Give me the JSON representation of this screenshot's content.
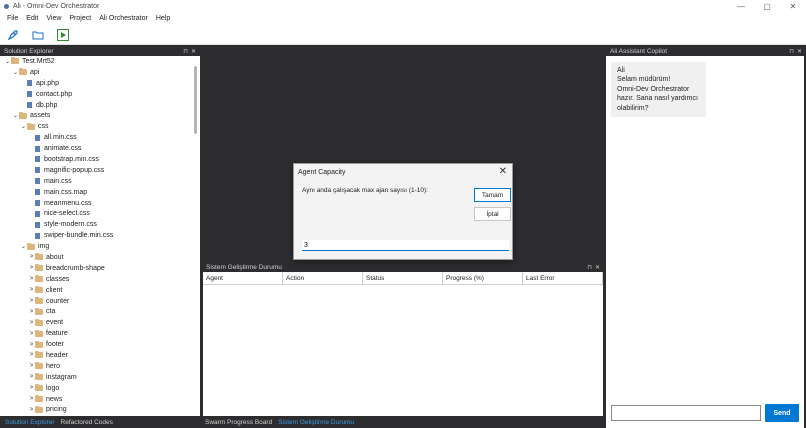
{
  "window": {
    "title": "Ali - Omni-Dev Orchestrator",
    "minimize": "—",
    "maximize": "▢",
    "close": "✕"
  },
  "menu": [
    "File",
    "Edit",
    "View",
    "Project",
    "Ali Orchestrator",
    "Help"
  ],
  "toolbar": {
    "icons": [
      "rocket-icon",
      "open-folder-icon",
      "run-icon"
    ]
  },
  "solution_explorer": {
    "title": "Solution Explorer",
    "tree": [
      {
        "label": "Test.Mrt52",
        "type": "folder",
        "depth": 0,
        "expanded": true
      },
      {
        "label": "api",
        "type": "folder",
        "depth": 1,
        "expanded": true
      },
      {
        "label": "api.php",
        "type": "file",
        "depth": 2
      },
      {
        "label": "contact.php",
        "type": "file",
        "depth": 2
      },
      {
        "label": "db.php",
        "type": "file",
        "depth": 2
      },
      {
        "label": "assets",
        "type": "folder",
        "depth": 1,
        "expanded": true
      },
      {
        "label": "css",
        "type": "folder",
        "depth": 2,
        "expanded": true
      },
      {
        "label": "all.min.css",
        "type": "file",
        "depth": 3
      },
      {
        "label": "animate.css",
        "type": "file",
        "depth": 3
      },
      {
        "label": "bootstrap.min.css",
        "type": "file",
        "depth": 3
      },
      {
        "label": "magnific-popup.css",
        "type": "file",
        "depth": 3
      },
      {
        "label": "main.css",
        "type": "file",
        "depth": 3
      },
      {
        "label": "main.css.map",
        "type": "file",
        "depth": 3
      },
      {
        "label": "meanmenu.css",
        "type": "file",
        "depth": 3
      },
      {
        "label": "nice-select.css",
        "type": "file",
        "depth": 3
      },
      {
        "label": "style-modern.css",
        "type": "file",
        "depth": 3
      },
      {
        "label": "swiper-bundle.min.css",
        "type": "file",
        "depth": 3
      },
      {
        "label": "img",
        "type": "folder",
        "depth": 2,
        "expanded": true
      },
      {
        "label": "about",
        "type": "folder",
        "depth": 3,
        "expanded": false
      },
      {
        "label": "breadcrumb-shape",
        "type": "folder",
        "depth": 3,
        "expanded": false
      },
      {
        "label": "classes",
        "type": "folder",
        "depth": 3,
        "expanded": false
      },
      {
        "label": "client",
        "type": "folder",
        "depth": 3,
        "expanded": false
      },
      {
        "label": "counter",
        "type": "folder",
        "depth": 3,
        "expanded": false
      },
      {
        "label": "cta",
        "type": "folder",
        "depth": 3,
        "expanded": false
      },
      {
        "label": "event",
        "type": "folder",
        "depth": 3,
        "expanded": false
      },
      {
        "label": "feature",
        "type": "folder",
        "depth": 3,
        "expanded": false
      },
      {
        "label": "footer",
        "type": "folder",
        "depth": 3,
        "expanded": false
      },
      {
        "label": "header",
        "type": "folder",
        "depth": 3,
        "expanded": false
      },
      {
        "label": "hero",
        "type": "folder",
        "depth": 3,
        "expanded": false
      },
      {
        "label": "instagram",
        "type": "folder",
        "depth": 3,
        "expanded": false
      },
      {
        "label": "logo",
        "type": "folder",
        "depth": 3,
        "expanded": false
      },
      {
        "label": "news",
        "type": "folder",
        "depth": 3,
        "expanded": false
      },
      {
        "label": "pricing",
        "type": "folder",
        "depth": 3,
        "expanded": false
      }
    ]
  },
  "left_tabs": [
    {
      "label": "Solution Explorer",
      "active": true
    },
    {
      "label": "Refactored Codes",
      "active": false
    }
  ],
  "swarm_panel": {
    "title": "Sistem Geliştirme Durumu",
    "columns": [
      "Agent",
      "Action",
      "Status",
      "Progress (%)",
      "Last Error"
    ]
  },
  "center_tabs": [
    {
      "label": "Swarm Progress Board",
      "active": false
    },
    {
      "label": "Sistem Geliştirme Durumu",
      "active": true
    }
  ],
  "copilot": {
    "title": "Ali Assistant Copilot",
    "messages": [
      {
        "lines": [
          "Ali",
          "Selam müdürüm!",
          "Omni-Dev Orchestrator",
          "hazır. Sana nasıl yardımcı",
          "olabilirim?"
        ]
      }
    ],
    "send_label": "Send",
    "input_value": ""
  },
  "dialog": {
    "title": "Agent Capacity",
    "prompt": "Aynı anda çalışacak max ajan sayısı (1-10):",
    "ok_label": "Tamam",
    "cancel_label": "İptal",
    "input_value": "3",
    "close": "✕"
  },
  "panel_controls": {
    "pin": "⊓",
    "close": "✕"
  },
  "colors": {
    "accent": "#0078d4",
    "dark_bg": "#2d2d30",
    "active_tab": "#3c9be0",
    "folder": "#dcb67a"
  }
}
